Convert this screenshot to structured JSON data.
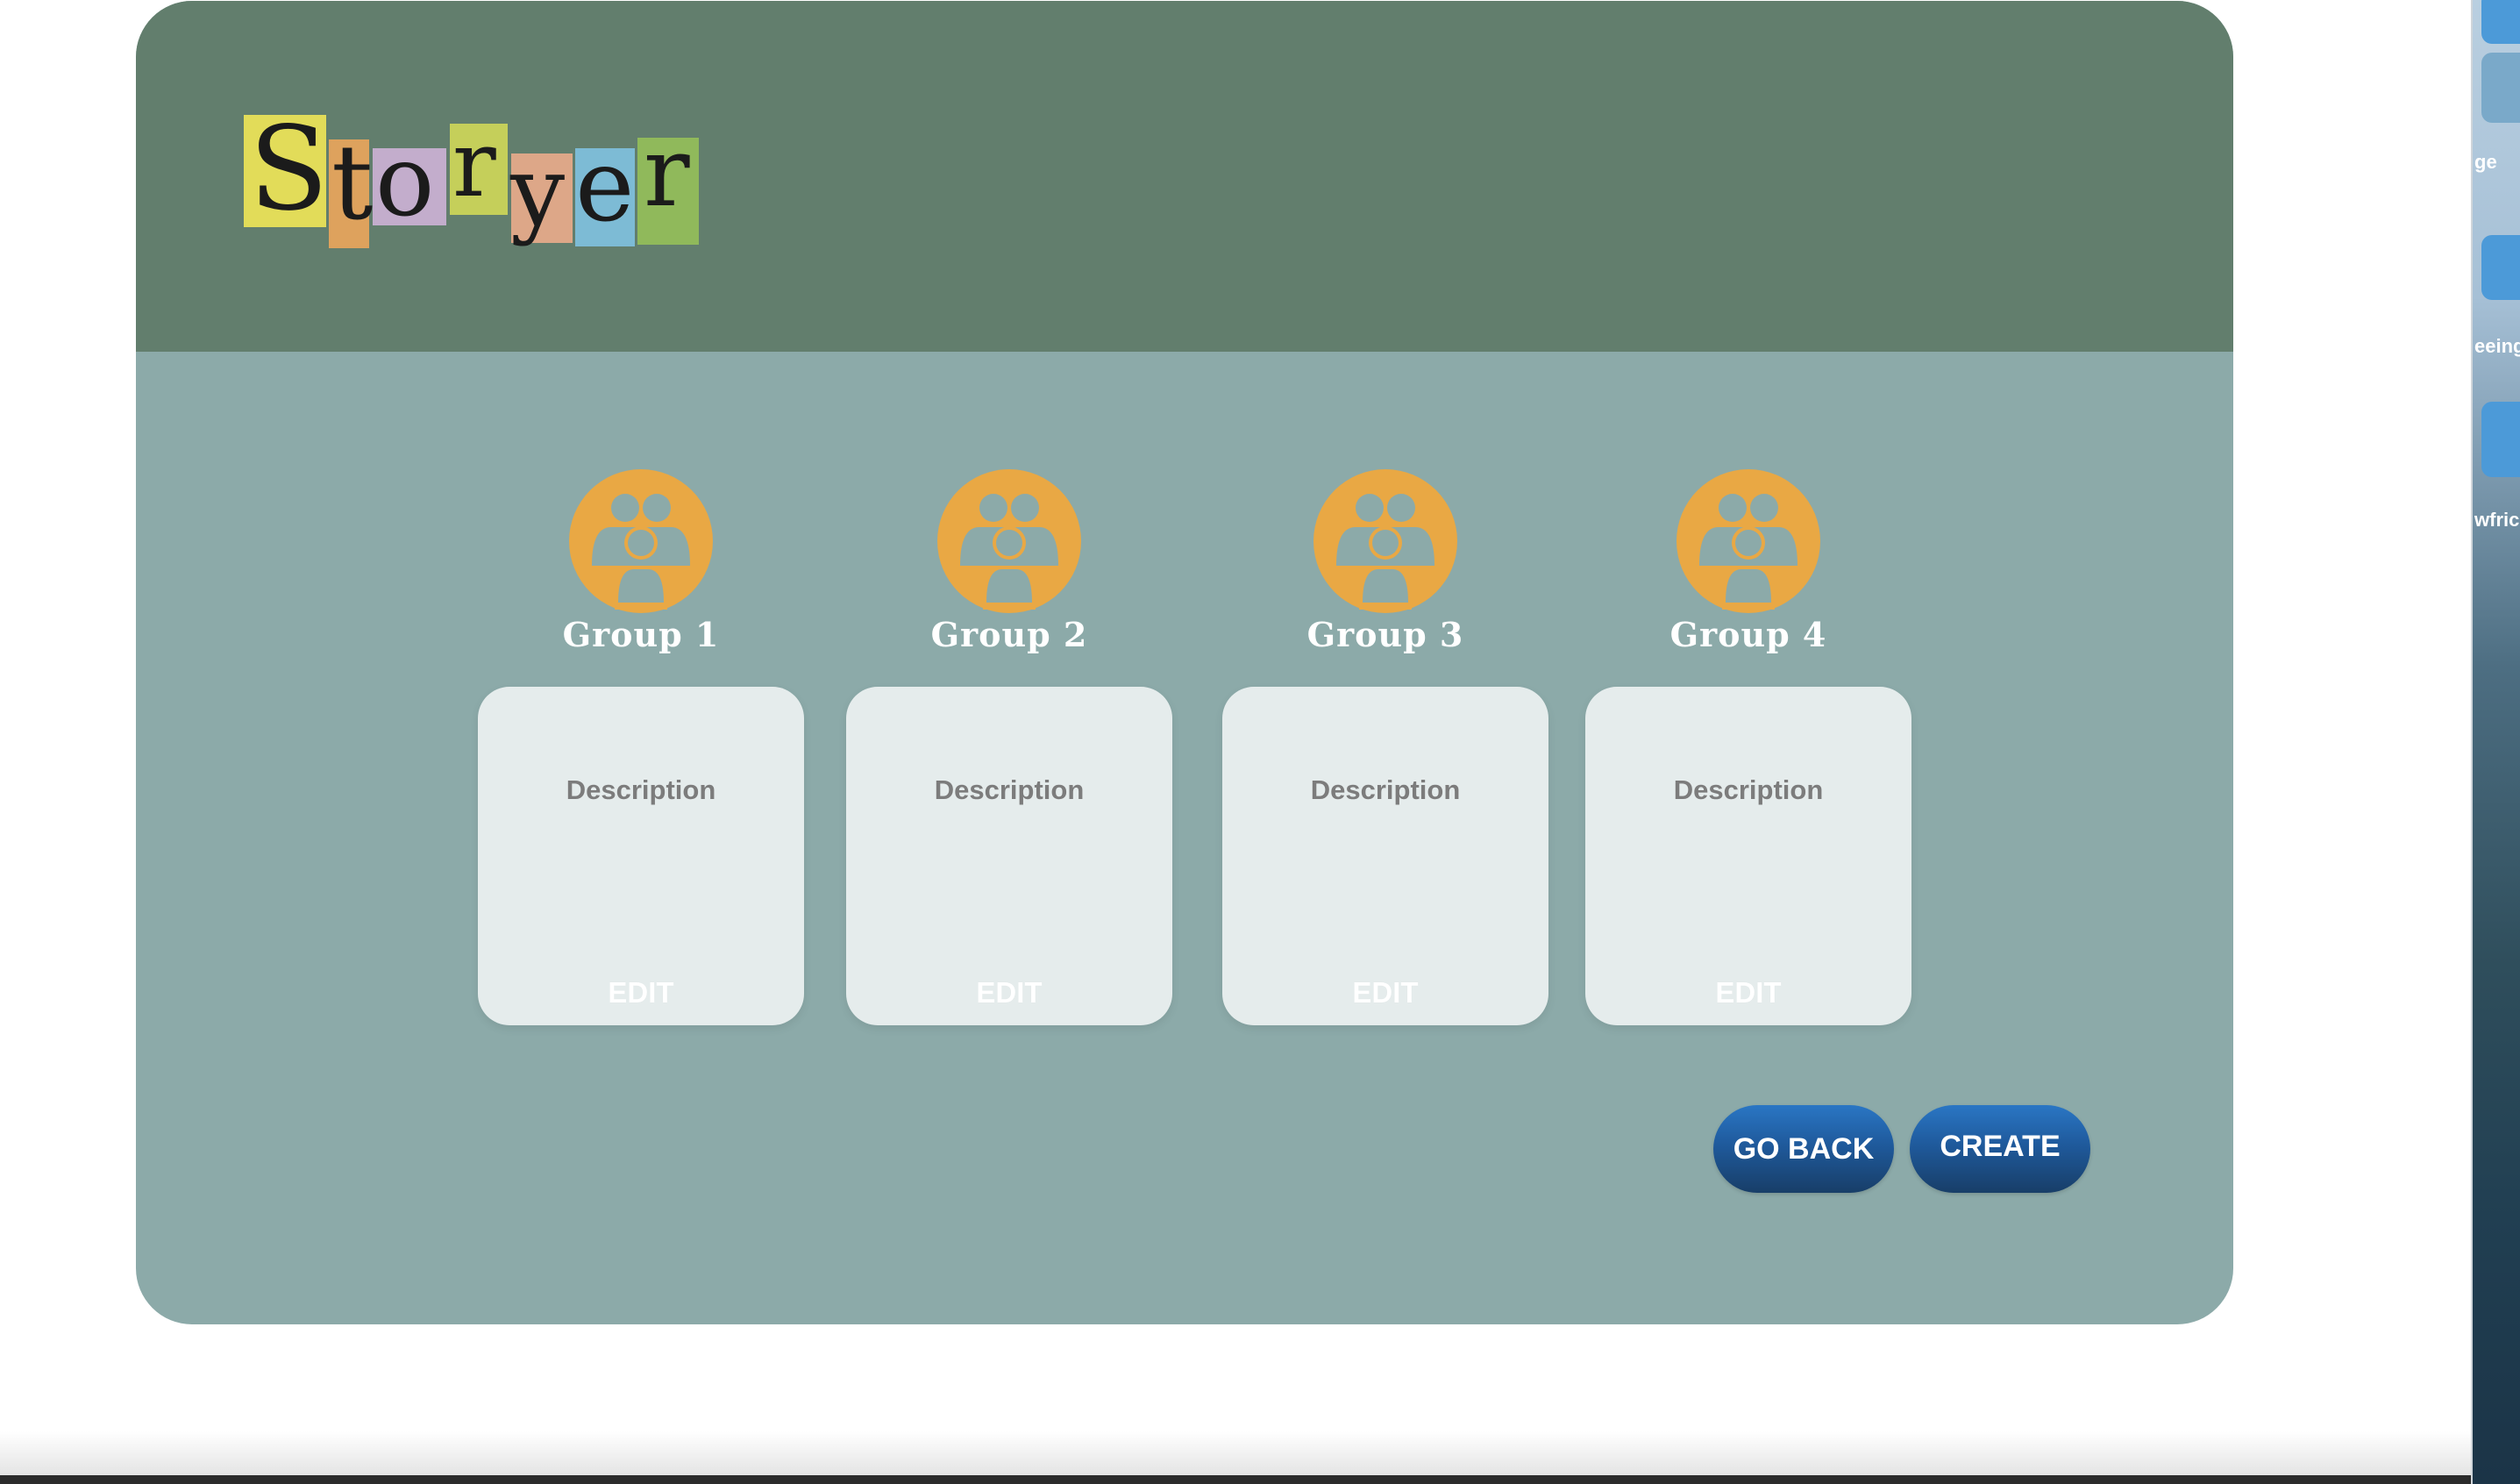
{
  "app": {
    "logo_text": "Storyer",
    "logo_letters": [
      "S",
      "t",
      "o",
      "r",
      "y",
      "e",
      "r"
    ],
    "logo_colors": [
      "#e2dc59",
      "#dea25d",
      "#c3adcc",
      "#c5cf5a",
      "#dda788",
      "#7dbbd5",
      "#90b95b"
    ]
  },
  "groups": [
    {
      "name": "Group 1",
      "description": "Description",
      "edit_label": "EDIT",
      "icon": "group-icon"
    },
    {
      "name": "Group 2",
      "description": "Description",
      "edit_label": "EDIT",
      "icon": "group-icon"
    },
    {
      "name": "Group 3",
      "description": "Description",
      "edit_label": "EDIT",
      "icon": "group-icon"
    },
    {
      "name": "Group 4",
      "description": "Description",
      "edit_label": "EDIT",
      "icon": "group-icon"
    }
  ],
  "actions": {
    "go_back_label": "GO BACK",
    "create_label": "CREATE"
  },
  "desktop_strip": {
    "labels": [
      "ge",
      "eeing",
      "wfric"
    ]
  },
  "colors": {
    "header": "#627e6d",
    "body": "#8caaa9",
    "avatar": "#e9a844",
    "card": "#e5ecec",
    "button": "#1f5a9c"
  }
}
